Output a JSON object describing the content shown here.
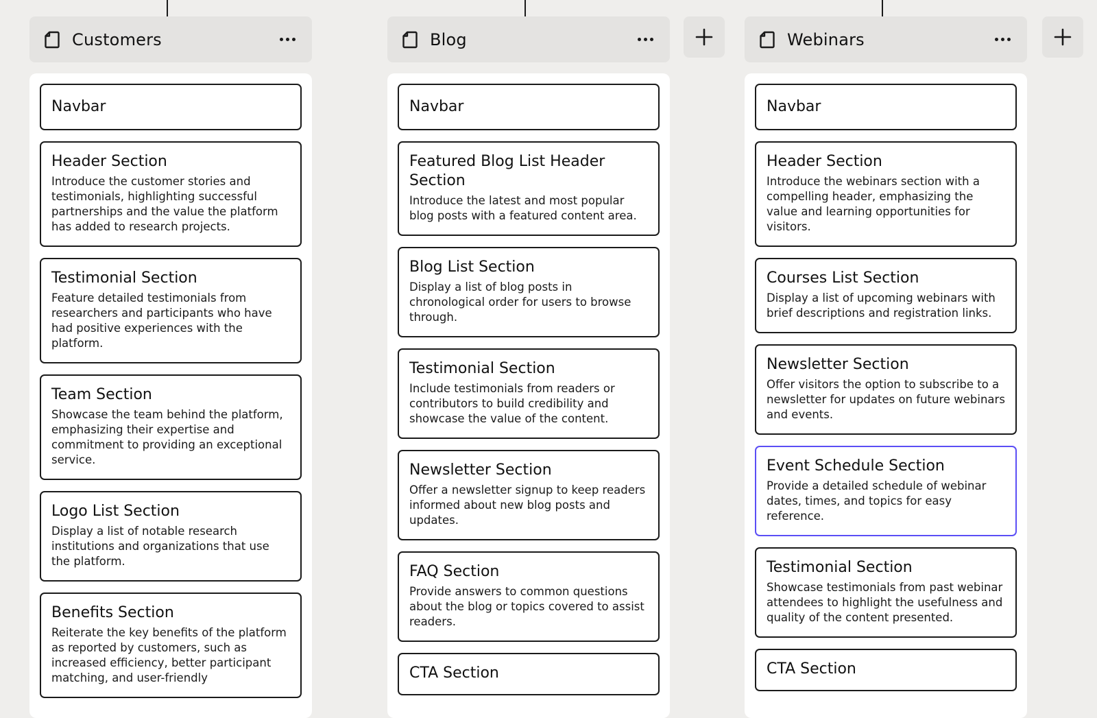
{
  "icons": {
    "page": "page-icon",
    "more": "more-icon",
    "add": "plus-icon"
  },
  "colors": {
    "background": "#efeeec",
    "header": "#e4e3e1",
    "border": "#1a1a1a",
    "selected": "#5b4ef5"
  },
  "columns": [
    {
      "title": "Customers",
      "cards": [
        {
          "title": "Navbar",
          "desc": ""
        },
        {
          "title": "Header Section",
          "desc": "Introduce the customer stories and testimonials, highlighting successful partnerships and the value the platform has added to research projects."
        },
        {
          "title": "Testimonial Section",
          "desc": "Feature detailed testimonials from researchers and participants who have had positive experiences with the platform."
        },
        {
          "title": "Team Section",
          "desc": "Showcase the team behind the platform, emphasizing their expertise and commitment to providing an exceptional service."
        },
        {
          "title": "Logo List Section",
          "desc": "Display a list of notable research institutions and organizations that use the platform."
        },
        {
          "title": "Benefits Section",
          "desc": "Reiterate the key benefits of the platform as reported by customers, such as increased efficiency, better participant matching, and user-friendly"
        }
      ]
    },
    {
      "title": "Blog",
      "cards": [
        {
          "title": "Navbar",
          "desc": ""
        },
        {
          "title": "Featured Blog List Header Section",
          "desc": "Introduce the latest and most popular blog posts with a featured content area."
        },
        {
          "title": "Blog List Section",
          "desc": "Display a list of blog posts in chronological order for users to browse through."
        },
        {
          "title": "Testimonial Section",
          "desc": "Include testimonials from readers or contributors to build credibility and showcase the value of the content."
        },
        {
          "title": "Newsletter Section",
          "desc": "Offer a newsletter signup to keep readers informed about new blog posts and updates."
        },
        {
          "title": "FAQ Section",
          "desc": "Provide answers to common questions about the blog or topics covered to assist readers."
        },
        {
          "title": "CTA Section",
          "desc": ""
        }
      ]
    },
    {
      "title": "Webinars",
      "cards": [
        {
          "title": "Navbar",
          "desc": ""
        },
        {
          "title": "Header Section",
          "desc": "Introduce the webinars section with a compelling header, emphasizing the value and learning opportunities for visitors."
        },
        {
          "title": "Courses List Section",
          "desc": "Display a list of upcoming webinars with brief descriptions and registration links."
        },
        {
          "title": "Newsletter Section",
          "desc": "Offer visitors the option to subscribe to a newsletter for updates on future webinars and events."
        },
        {
          "title": "Event Schedule Section",
          "desc": "Provide a detailed schedule of webinar dates, times, and topics for easy reference."
        },
        {
          "title": "Testimonial Section",
          "desc": "Showcase testimonials from past webinar attendees to highlight the usefulness and quality of the content presented."
        },
        {
          "title": "CTA Section",
          "desc": ""
        }
      ]
    }
  ]
}
